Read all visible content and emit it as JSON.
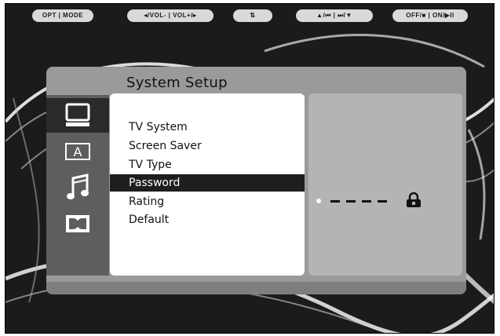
{
  "remote_hints": [
    {
      "label": "OPT | MODE"
    },
    {
      "label": "◂/VOL- | VOL+/▸"
    },
    {
      "label": "⇅"
    },
    {
      "label": "▲/⏮ | ⏭/▼"
    },
    {
      "label": "OFF/■ | ON/▶II"
    }
  ],
  "menu": {
    "title": "System Setup",
    "sidebar": [
      {
        "icon": "tv-icon",
        "active": true
      },
      {
        "icon": "language-a-icon",
        "active": false
      },
      {
        "icon": "music-note-icon",
        "active": false
      },
      {
        "icon": "dolby-icon",
        "active": false
      }
    ],
    "items": [
      "TV System",
      "Screen Saver",
      "TV Type",
      "Password",
      "Rating",
      "Default"
    ],
    "selected_index": 3,
    "password": {
      "value": "----",
      "icon": "lock-icon"
    }
  },
  "colors": {
    "screen_bg": "#1b1b1b",
    "frame": "#9a9a9a",
    "sidebar": "#5e5e5e",
    "selected_bg": "#1e1e1e",
    "value_panel": "#b4b4b4"
  }
}
